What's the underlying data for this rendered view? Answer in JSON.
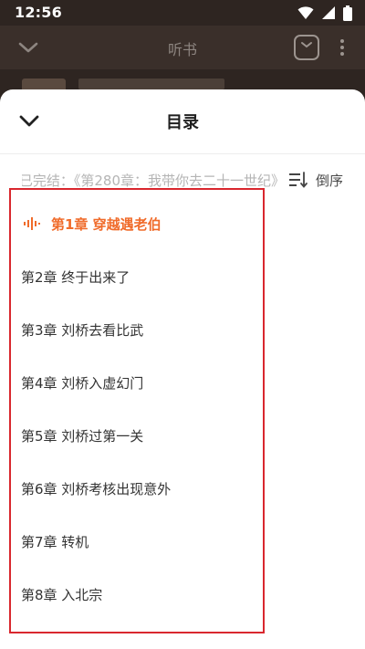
{
  "status_bar": {
    "time": "12:56",
    "icons": [
      "wifi-icon",
      "signal-icon",
      "battery-icon"
    ]
  },
  "app_header": {
    "title": "听书"
  },
  "sheet": {
    "title": "目录",
    "progress_text": "已完结：《第280章：我带你去二十一世纪》",
    "sort_label": "倒序"
  },
  "chapters": [
    {
      "label": "第1章 穿越遇老伯",
      "active": true
    },
    {
      "label": "第2章 终于出来了",
      "active": false
    },
    {
      "label": "第3章 刘桥去看比武",
      "active": false
    },
    {
      "label": "第4章 刘桥入虚幻门",
      "active": false
    },
    {
      "label": "第5章 刘桥过第一关",
      "active": false
    },
    {
      "label": "第6章 刘桥考核出现意外",
      "active": false
    },
    {
      "label": "第7章 转机",
      "active": false
    },
    {
      "label": "第8章 入北宗",
      "active": false
    }
  ],
  "colors": {
    "accent": "#f06b2a",
    "highlight_border": "#d9272e",
    "overlay_bg": "#2e2521"
  }
}
